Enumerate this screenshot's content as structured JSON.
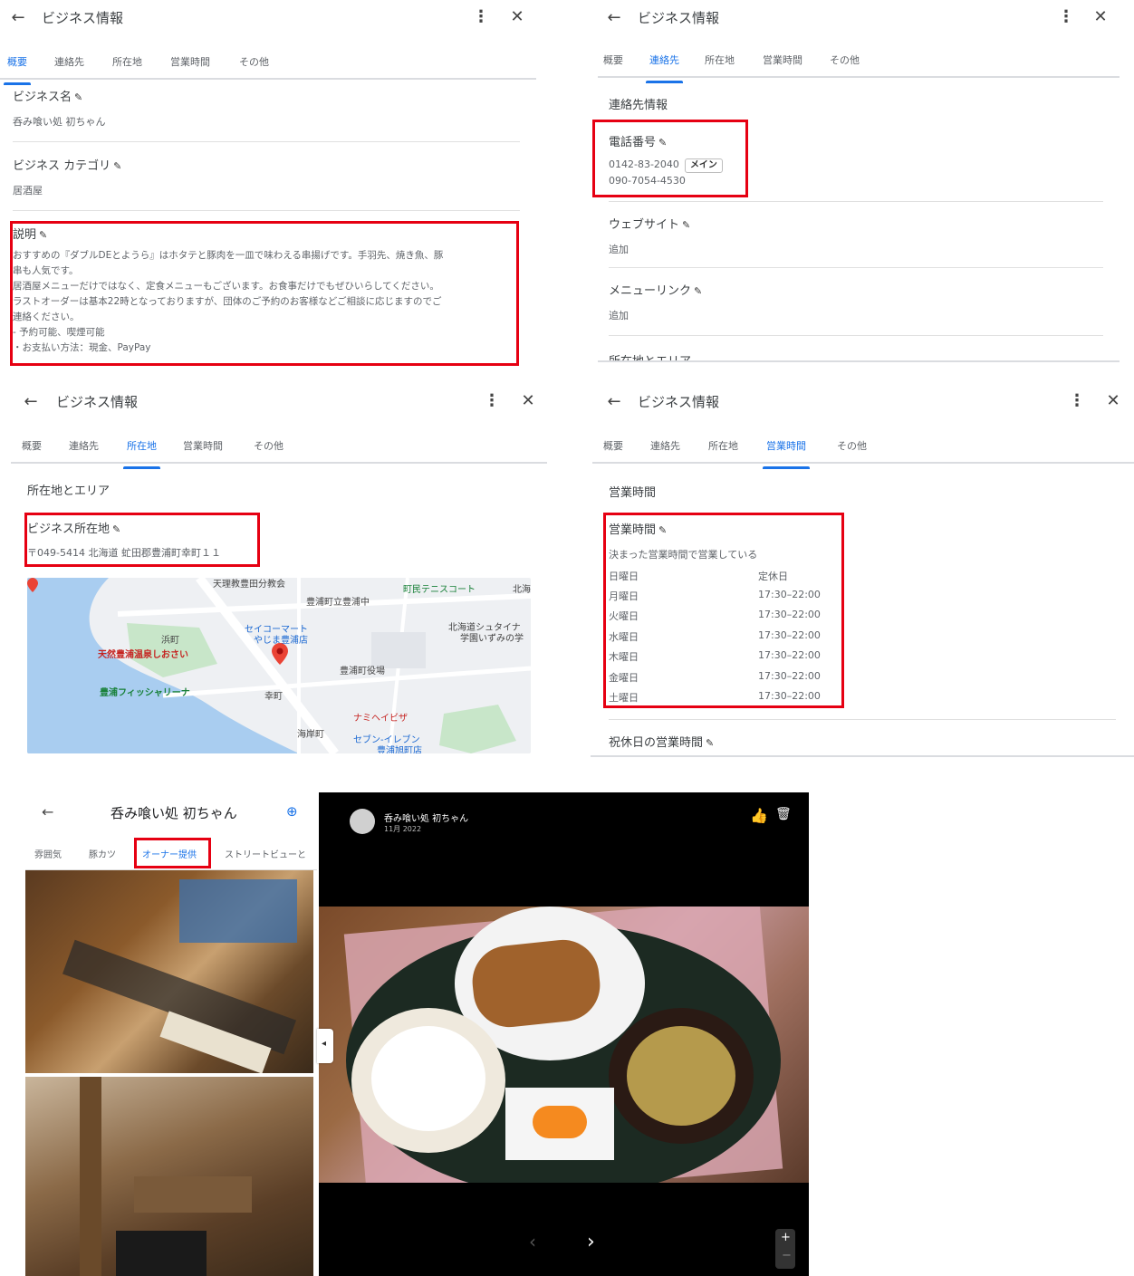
{
  "overview": {
    "header": {
      "title": "ビジネス情報"
    },
    "tabs": [
      "概要",
      "連絡先",
      "所在地",
      "営業時間",
      "その他"
    ],
    "business_name_label": "ビジネス名",
    "business_name_value": "呑み喰い処 初ちゃん",
    "category_label": "ビジネス カテゴリ",
    "category_value": "居酒屋",
    "description_label": "説明",
    "description_lines": [
      "おすすめの『ダブルDEとようら』はホタテと豚肉を一皿で味わえる串揚げです。手羽先、焼き魚、豚",
      "串も人気です。",
      "居酒屋メニューだけではなく、定食メニューもございます。お食事だけでもぜひいらしてください。",
      "ラストオーダーは基本22時となっておりますが、団体のご予約のお客様などご相談に応じますのでご",
      "連絡ください。",
      "- 予約可能、喫煙可能",
      "・お支払い方法：現金、PayPay"
    ]
  },
  "contact": {
    "header": {
      "title": "ビジネス情報"
    },
    "tabs": [
      "概要",
      "連絡先",
      "所在地",
      "営業時間",
      "その他"
    ],
    "section_title": "連絡先情報",
    "phone_label": "電話番号",
    "phone_main": "0142-83-2040",
    "phone_main_badge": "メイン",
    "phone_secondary": "090-7054-4530",
    "website_label": "ウェブサイト",
    "website_value": "追加",
    "menu_label": "メニューリンク",
    "menu_value": "追加",
    "location_label_partial": "所在地とエリア"
  },
  "location": {
    "header": {
      "title": "ビジネス情報"
    },
    "tabs": [
      "概要",
      "連絡先",
      "所在地",
      "営業時間",
      "その他"
    ],
    "section_title": "所在地とエリア",
    "address_label": "ビジネス所在地",
    "address_value": "〒049-5414 北海道 虻田郡豊浦町幸町１１",
    "map_labels": {
      "church": "天理教豊田分教会",
      "school": "豊浦町立豊浦中",
      "tennis": "町民テニスコート",
      "kita": "北海",
      "seicomart": "セイコーマート",
      "seicomart2": "やじま豊浦店",
      "hokkaido_school": "北海道シュタイナ",
      "hokkaido_school2": "学園いずみの学",
      "hamacho": "浜町",
      "onsen": "天然豊浦温泉しおさい",
      "townhall": "豊浦町役場",
      "fishery": "豊浦フィッシャリーナ",
      "saiwaicho": "幸町",
      "namihei": "ナミヘイビザ",
      "kaiganmachi": "海岸町",
      "seven": "セブン-イレブン",
      "seven2": "豊浦旭町店"
    }
  },
  "hours": {
    "header": {
      "title": "ビジネス情報"
    },
    "tabs": [
      "概要",
      "連絡先",
      "所在地",
      "営業時間",
      "その他"
    ],
    "section_title": "営業時間",
    "hours_label": "営業時間",
    "hours_mode": "決まった営業時間で営業している",
    "rows": [
      {
        "day": "日曜日",
        "time": "定休日"
      },
      {
        "day": "月曜日",
        "time": "17:30–22:00"
      },
      {
        "day": "火曜日",
        "time": "17:30–22:00"
      },
      {
        "day": "水曜日",
        "time": "17:30–22:00"
      },
      {
        "day": "木曜日",
        "time": "17:30–22:00"
      },
      {
        "day": "金曜日",
        "time": "17:30–22:00"
      },
      {
        "day": "土曜日",
        "time": "17:30–22:00"
      }
    ],
    "holiday_label": "祝休日の営業時間"
  },
  "gallery": {
    "title": "呑み喰い処 初ちゃん",
    "tabs": [
      "雰囲気",
      "豚カツ",
      "オーナー提供",
      "ストリートビューと"
    ]
  },
  "viewer": {
    "author": "呑み喰い処 初ちゃん",
    "date": "11月 2022"
  },
  "colors": {
    "accent": "#1a73e8",
    "highlight": "#e60012"
  }
}
